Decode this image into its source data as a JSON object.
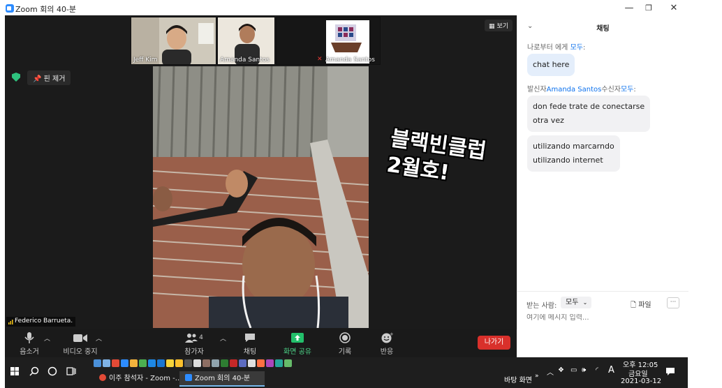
{
  "window": {
    "title": "Zoom 회의 40-분",
    "minimize": "—",
    "maximize": "❐",
    "close": "✕"
  },
  "meeting": {
    "view_label": "보기",
    "unpin_label": "핀 제거",
    "thumbnails": [
      {
        "name": "Jeff Kim"
      },
      {
        "name": "Amanda Santos"
      },
      {
        "name": "Amanda Santos"
      }
    ],
    "active_speaker": "Federico Barrueta.",
    "overlay_text": "블랙빈클럽\n2월호!"
  },
  "toolbar": {
    "mute_label": "음소거",
    "video_label": "비디오 중지",
    "participants_label": "참가자",
    "participants_count": "4",
    "chat_label": "채팅",
    "share_label": "화면 공유",
    "record_label": "기록",
    "reactions_label": "반응",
    "leave_label": "나가기"
  },
  "chat": {
    "title": "채팅",
    "messages": [
      {
        "from_prefix": "나로부터 에게 ",
        "to": "모두",
        "suffix": ":",
        "text": "chat here"
      },
      {
        "from_prefix": "발신자",
        "sender": "Amanda Santos",
        "mid": "수신자",
        "to": "모두",
        "suffix": ":",
        "bubbles": [
          "don fede trate de conectarse\notra vez",
          "utilizando marcarndo\nutilizando internet"
        ]
      }
    ],
    "to_label": "받는 사람:",
    "to_value": "모두",
    "file_label": "파일",
    "more_label": "···",
    "input_placeholder": "여기에 메시지 입력..."
  },
  "taskbar": {
    "task1": "이주 참석자 - Zoom -...",
    "task2": "Zoom 회의 40-분",
    "desktop_label": "바탕 화면",
    "ime": "A",
    "time": "오후 12:05",
    "weekday": "금요일",
    "date": "2021-03-12"
  }
}
